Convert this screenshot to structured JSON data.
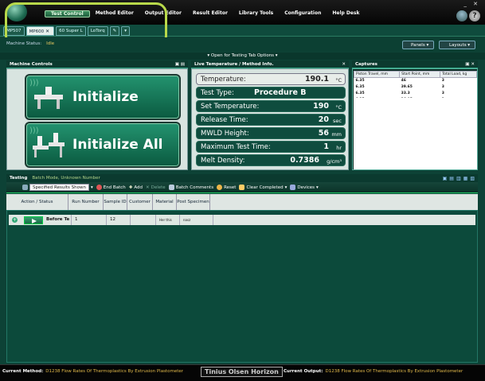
{
  "menu": [
    "Test Control",
    "Method Editor",
    "Output Editor",
    "Result Editor",
    "Library Tools",
    "Configuration",
    "Help Desk"
  ],
  "window_controls": "_ ✕",
  "tabs": [
    "MP507",
    "MP600",
    "60 Super L",
    "LoTorq"
  ],
  "machine_status": {
    "label": "Machine Status:",
    "value": "Idle"
  },
  "panels_label": "Panels",
  "layouts_label": "Layouts",
  "open_tab_options": "▾  Open for Testing Tab Options  ▾",
  "machine_controls": {
    "title": "Machine Controls",
    "initialize": "Initialize",
    "initialize_all": "Initialize All"
  },
  "live_temp": {
    "title": "Live Temperature / Method Info.",
    "temperature": {
      "label": "Temperature:",
      "value": "190.1",
      "unit": "°C"
    },
    "test_type": {
      "label": "Test Type:",
      "value": "Procedure B"
    },
    "set_temp": {
      "label": "Set Temperature:",
      "value": "190",
      "unit": "°C"
    },
    "release_time": {
      "label": "Release Time:",
      "value": "20",
      "unit": "sec"
    },
    "mwld_height": {
      "label": "MWLD Height:",
      "value": "56",
      "unit": "mm"
    },
    "max_test_time": {
      "label": "Maximum Test Time:",
      "value": "1",
      "unit": "hr"
    },
    "melt_density": {
      "label": "Melt Density:",
      "value": "0.7386",
      "unit": "g/cm³"
    }
  },
  "captures": {
    "title": "Captures",
    "columns": [
      "Piston Travel, mm",
      "Start Point, mm",
      "Total Load, kg"
    ],
    "rows": [
      [
        "6.35",
        "46",
        "3"
      ],
      [
        "6.35",
        "39.65",
        "3"
      ],
      [
        "6.35",
        "33.3",
        "3"
      ],
      [
        "6.35",
        "26.95",
        "3"
      ]
    ]
  },
  "testing": {
    "title": "Testing",
    "subtitle": "Batch Mode, Unknown Number",
    "toolbar": {
      "results_select": "Specified Results Shown",
      "end_batch": "End Batch",
      "add": "Add",
      "delete": "Delete",
      "batch_comments": "Batch Comments",
      "reset": "Reset",
      "clear_completed": "Clear Completed",
      "devices": "Devices"
    },
    "columns": [
      "Action / Status",
      "Run Number",
      "Sample ID",
      "Customer",
      "Material",
      "Post Specimen"
    ],
    "row": {
      "status": "Before Te",
      "run_number": "1",
      "sample_id": "12",
      "material": "Her this",
      "post": "nasz"
    }
  },
  "footer": {
    "current_method_label": "Current Method:",
    "current_method": "D1238 Flow Rates Of Thermoplastics By Extrusion Plastometer",
    "brand": "Tinius Olsen Horizon",
    "current_output_label": "Current Output:",
    "current_output": "D1238 Flow Rates Of Thermoplastics By Extrusion Plastometer"
  }
}
